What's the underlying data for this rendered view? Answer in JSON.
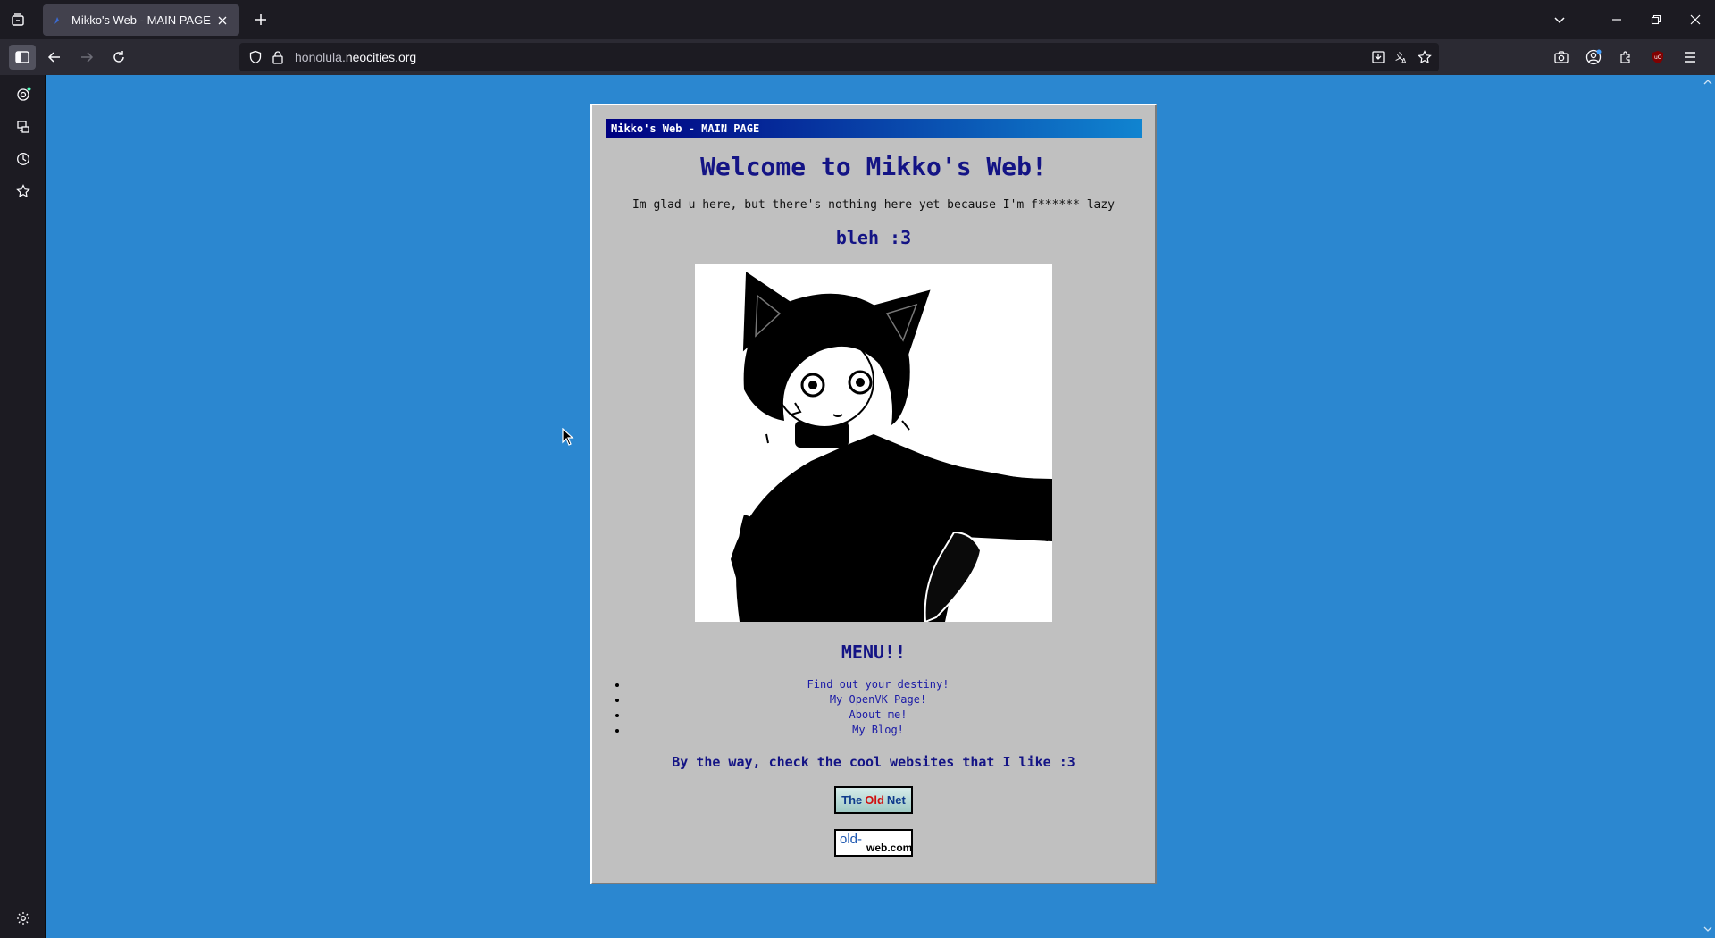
{
  "browser": {
    "tab": {
      "title": "Mikko's Web - MAIN PAGE"
    },
    "url": {
      "sub": "honolula.",
      "host": "neocities.org"
    }
  },
  "page": {
    "panel_title": "Mikko's Web - MAIN PAGE",
    "welcome": "Welcome to Mikko's Web!",
    "intro": "Im glad u here, but there's nothing here yet because I'm f****** lazy",
    "bleh": "bleh :3",
    "menu_title": "MENU!!",
    "menu_items": [
      "Find out your destiny!",
      "My OpenVK Page!",
      "About me!",
      "My Blog!"
    ],
    "byway": "By the way, check the cool websites that I like :3",
    "badges": {
      "oldnet": {
        "the": "The",
        "old": "Old",
        "net": "Net"
      },
      "oldweb": {
        "old": "old-",
        "web": "web.com"
      }
    }
  },
  "colors": {
    "page_bg": "#2b87d0",
    "panel_bg": "#c0c0c0",
    "heading": "#141485",
    "link": "#1a1aa6"
  }
}
